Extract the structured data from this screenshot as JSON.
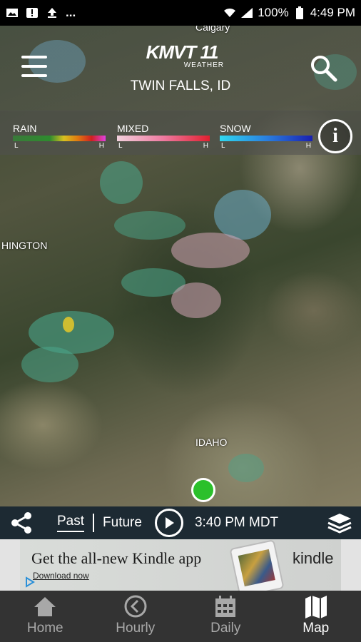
{
  "status_bar": {
    "battery_percent": "100%",
    "time": "4:49 PM",
    "icons": [
      "image-icon",
      "alert-icon",
      "upload-icon",
      "more-dots-icon",
      "wifi-icon",
      "signal-icon",
      "battery-icon"
    ],
    "more_label": "..."
  },
  "header": {
    "brand_name": "KMVT 11",
    "brand_sub": "WEATHER",
    "location": "TWIN FALLS, ID"
  },
  "legend": {
    "rain": {
      "label": "RAIN",
      "low": "L",
      "high": "H"
    },
    "mixed": {
      "label": "MIXED",
      "low": "L",
      "high": "H"
    },
    "snow": {
      "label": "SNOW",
      "low": "L",
      "high": "H"
    },
    "info_glyph": "i"
  },
  "map_labels": {
    "calgary": "Calgary",
    "washington": "HINGTON",
    "idaho": "IDAHO"
  },
  "controls": {
    "past_label": "Past",
    "future_label": "Future",
    "time_label": "3:40 PM MDT",
    "selected_tab": "Past"
  },
  "ad": {
    "headline": "Get the all-new Kindle app",
    "cta": "Download now",
    "brand": "kindle"
  },
  "nav": {
    "items": [
      {
        "label": "Home",
        "icon": "home-icon"
      },
      {
        "label": "Hourly",
        "icon": "clock-back-icon"
      },
      {
        "label": "Daily",
        "icon": "calendar-icon"
      },
      {
        "label": "Map",
        "icon": "map-icon"
      }
    ],
    "active": "Map"
  },
  "colors": {
    "radar_teal": "#4aa58a",
    "radar_pink": "#d4a5b7",
    "radar_blue": "#6fb6d6",
    "location_dot": "#2bc02b",
    "control_bar": "#1d2a33",
    "nav_bg": "#333333"
  }
}
